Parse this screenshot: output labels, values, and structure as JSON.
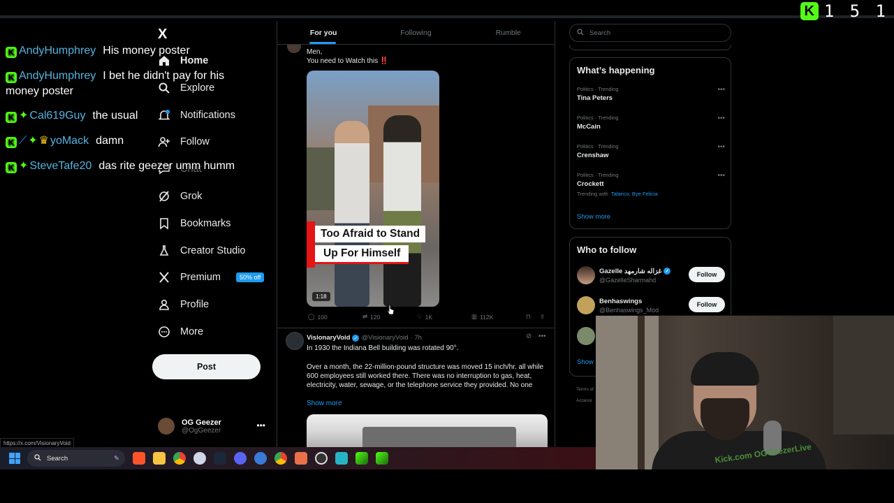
{
  "viewer_count": "1 5 1",
  "chat": [
    {
      "user": "AndyHumphrey",
      "message": "His money poster",
      "badges": [
        "kick"
      ]
    },
    {
      "user": "AndyHumphrey",
      "message": "I bet he didn't pay for his money poster",
      "badges": [
        "kick"
      ]
    },
    {
      "user": "Cal619Guy",
      "message": "the usual",
      "badges": [
        "kick",
        "gem"
      ]
    },
    {
      "user": "yoMack",
      "message": "damn",
      "badges": [
        "kick",
        "sword",
        "gem",
        "crown"
      ]
    },
    {
      "user": "SteveTafe20",
      "message": "das rite geezer umm humm",
      "badges": [
        "kick",
        "gem"
      ]
    }
  ],
  "nav": {
    "logo": "X",
    "items": [
      {
        "label": "Home",
        "icon": "home-icon"
      },
      {
        "label": "Explore",
        "icon": "search-icon"
      },
      {
        "label": "Notifications",
        "icon": "bell-icon"
      },
      {
        "label": "Follow",
        "icon": "person-plus-icon"
      },
      {
        "label": "Chat",
        "icon": "chat-icon"
      },
      {
        "label": "Grok",
        "icon": "grok-icon"
      },
      {
        "label": "Bookmarks",
        "icon": "bookmark-icon"
      },
      {
        "label": "Creator Studio",
        "icon": "flask-icon"
      },
      {
        "label": "Premium",
        "icon": "x-icon",
        "badge": "50% off"
      },
      {
        "label": "Profile",
        "icon": "person-icon"
      },
      {
        "label": "More",
        "icon": "more-circle-icon"
      }
    ],
    "post_button": "Post",
    "account": {
      "name": "OG Geezer",
      "handle": "@OgGeezer"
    }
  },
  "status_url": "https://x.com/VisionaryVoid",
  "tabs": [
    "For you",
    "Following",
    "Rumble"
  ],
  "post1": {
    "text_line1": "Men,",
    "text_line2": "You need to Watch this ‼️",
    "video_caption_1": "Too Afraid to Stand",
    "video_caption_2": "Up For Himself",
    "duration": "1:18",
    "replies": "100",
    "reposts": "120",
    "likes": "1K",
    "views": "112K"
  },
  "post2": {
    "name": "VisionaryVoid",
    "handle": "@VisionaryVoid",
    "time": "· 7h",
    "text1": "In 1930 the Indiana Bell building was rotated 90°.",
    "text2": "Over a month, the 22-million-pound structure was moved 15 inch/hr. all while 600 employees still worked there. There was no interruption to gas, heat, electricity, water, sewage, or the telephone service they provided. No one",
    "show_more": "Show more"
  },
  "search": {
    "placeholder": "Search"
  },
  "whats_happening": {
    "title": "What’s happening",
    "trends": [
      {
        "meta": "Politics · Trending",
        "name": "Tina Peters"
      },
      {
        "meta": "Politics · Trending",
        "name": "McCain"
      },
      {
        "meta": "Politics · Trending",
        "name": "Crenshaw"
      },
      {
        "meta": "Politics · Trending",
        "name": "Crockett",
        "with_label": "Trending with",
        "with_tags": "Talarico, Bye Felicia"
      }
    ],
    "show_more": "Show more"
  },
  "who_to_follow": {
    "title": "Who to follow",
    "accounts": [
      {
        "name": "Gazelle غزاله شارمهد",
        "handle": "@GazelleSharmahd",
        "verified": true,
        "button": "Follow"
      },
      {
        "name": "Benhaswings",
        "handle": "@Benhaswings_Mod",
        "verified": false,
        "button": "Follow"
      }
    ],
    "show_more": "Show"
  },
  "legal": [
    "Terms of",
    "Accessi"
  ],
  "taskbar": {
    "search_label": "Search"
  },
  "webcam": {
    "shirt_text": "Kick.com OGGeezerLive"
  },
  "colors": {
    "accent": "#1d9bf0",
    "kick": "#53fc18",
    "chat_user": "#53b4e0"
  }
}
